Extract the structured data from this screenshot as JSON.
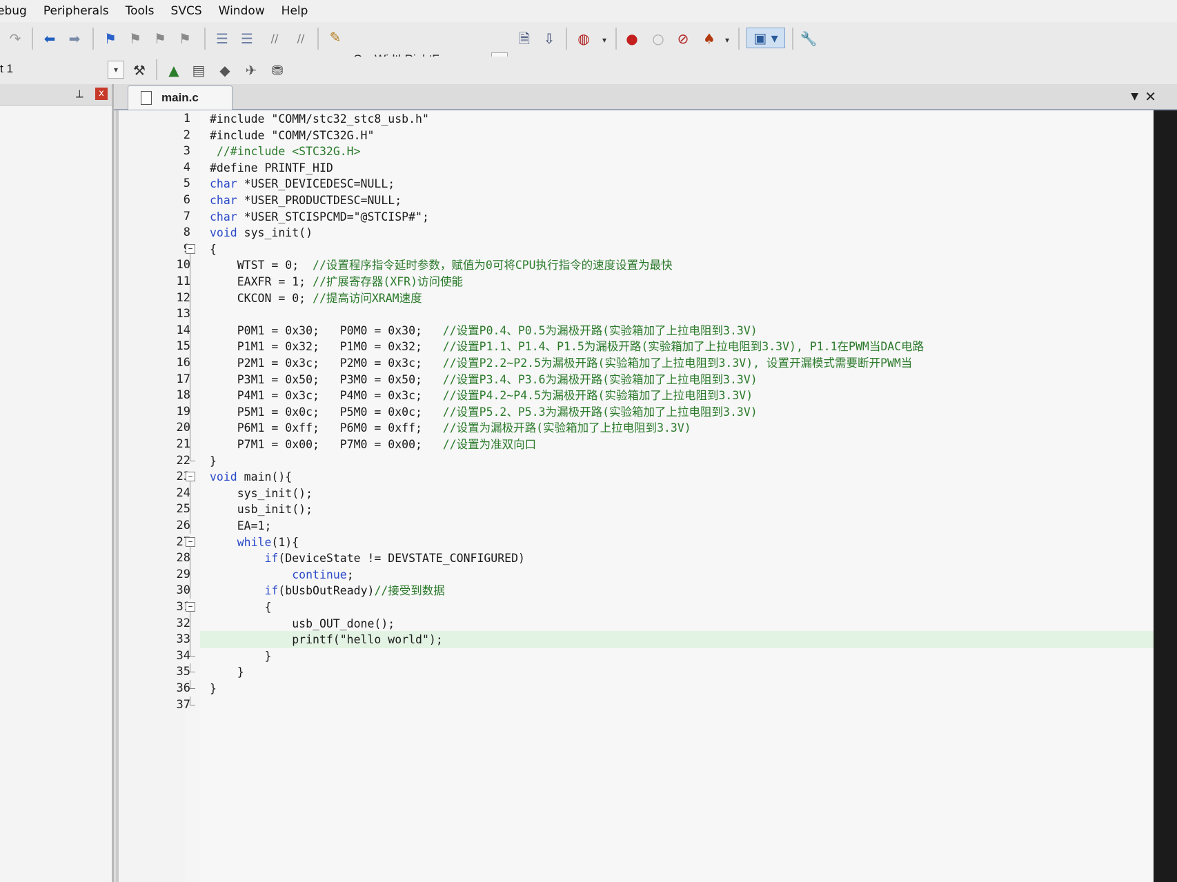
{
  "menu": [
    "ebug",
    "Peripherals",
    "Tools",
    "SVCS",
    "Window",
    "Help"
  ],
  "toolbar": {
    "target_name": "GusWidthRightFar",
    "project_target": "t 1",
    "icons": [
      "redo-icon",
      "back-icon",
      "forward-icon",
      "bookmark-icon",
      "prev-bookmark-icon",
      "next-bookmark-icon",
      "clear-bookmarks-icon",
      "indent-icon",
      "unindent-icon",
      "comment-icon",
      "uncomment-icon",
      "find-in-files-icon",
      "target-dropdown",
      "load-icon",
      "download-icon",
      "debug-session-icon",
      "breakpoint-icon",
      "disable-breakpoint-icon",
      "kill-breakpoints-icon",
      "kill-all-breakpoints-icon",
      "window-layout-icon",
      "configure-icon"
    ],
    "icons2": [
      "magic-wand-icon",
      "manage-components-icon",
      "select-packs-icon",
      "pack-installer-icon",
      "event-recorder-icon",
      "validate-runtime-icon"
    ]
  },
  "left_panel": {
    "pin": "⟂",
    "close": "x"
  },
  "editor": {
    "tab": "main.c",
    "lines": [
      {
        "n": "1",
        "t": "#include \"COMM/stc32_stc8_usb.h\""
      },
      {
        "n": "2",
        "t": "#include \"COMM/STC32G.H\""
      },
      {
        "n": "3",
        "t": " //#include <STC32G.H>"
      },
      {
        "n": "4",
        "t": "#define PRINTF_HID"
      },
      {
        "n": "5",
        "t": "char *USER_DEVICEDESC=NULL;"
      },
      {
        "n": "6",
        "t": "char *USER_PRODUCTDESC=NULL;"
      },
      {
        "n": "7",
        "t": "char *USER_STCISPCMD=\"@STCISP#\";"
      },
      {
        "n": "8",
        "t": "void sys_init()"
      },
      {
        "n": "9",
        "t": "{"
      },
      {
        "n": "10",
        "t": "    WTST = 0;  //设置程序指令延时参数，赋值为0可将CPU执行指令的速度设置为最快"
      },
      {
        "n": "11",
        "t": "    EAXFR = 1; //扩展寄存器(XFR)访问使能"
      },
      {
        "n": "12",
        "t": "    CKCON = 0; //提高访问XRAM速度"
      },
      {
        "n": "13",
        "t": ""
      },
      {
        "n": "14",
        "t": "    P0M1 = 0x30;   P0M0 = 0x30;   //设置P0.4、P0.5为漏极开路(实验箱加了上拉电阻到3.3V)"
      },
      {
        "n": "15",
        "t": "    P1M1 = 0x32;   P1M0 = 0x32;   //设置P1.1、P1.4、P1.5为漏极开路(实验箱加了上拉电阻到3.3V), P1.1在PWM当DAC电路"
      },
      {
        "n": "16",
        "t": "    P2M1 = 0x3c;   P2M0 = 0x3c;   //设置P2.2~P2.5为漏极开路(实验箱加了上拉电阻到3.3V), 设置开漏模式需要断开PWM当"
      },
      {
        "n": "17",
        "t": "    P3M1 = 0x50;   P3M0 = 0x50;   //设置P3.4、P3.6为漏极开路(实验箱加了上拉电阻到3.3V)"
      },
      {
        "n": "18",
        "t": "    P4M1 = 0x3c;   P4M0 = 0x3c;   //设置P4.2~P4.5为漏极开路(实验箱加了上拉电阻到3.3V)"
      },
      {
        "n": "19",
        "t": "    P5M1 = 0x0c;   P5M0 = 0x0c;   //设置P5.2、P5.3为漏极开路(实验箱加了上拉电阻到3.3V)"
      },
      {
        "n": "20",
        "t": "    P6M1 = 0xff;   P6M0 = 0xff;   //设置为漏极开路(实验箱加了上拉电阻到3.3V)"
      },
      {
        "n": "21",
        "t": "    P7M1 = 0x00;   P7M0 = 0x00;   //设置为准双向口"
      },
      {
        "n": "22",
        "t": "}"
      },
      {
        "n": "23",
        "t": "void main(){"
      },
      {
        "n": "24",
        "t": "    sys_init();"
      },
      {
        "n": "25",
        "t": "    usb_init();"
      },
      {
        "n": "26",
        "t": "    EA=1;"
      },
      {
        "n": "27",
        "t": "    while(1){"
      },
      {
        "n": "28",
        "t": "        if(DeviceState != DEVSTATE_CONFIGURED)"
      },
      {
        "n": "29",
        "t": "            continue;"
      },
      {
        "n": "30",
        "t": "        if(bUsbOutReady)//接受到数据"
      },
      {
        "n": "31",
        "t": "        {"
      },
      {
        "n": "32",
        "t": "            usb_OUT_done();"
      },
      {
        "n": "33",
        "t": "            printf(\"hello world\");"
      },
      {
        "n": "34",
        "t": "        }"
      },
      {
        "n": "35",
        "t": "    }"
      },
      {
        "n": "36",
        "t": "}"
      },
      {
        "n": "37",
        "t": ""
      }
    ],
    "highlight_line": 33
  },
  "colors": {
    "keyword": "#2848c8",
    "comment": "#2b7a2b",
    "highlight": "#e3f3e3"
  }
}
